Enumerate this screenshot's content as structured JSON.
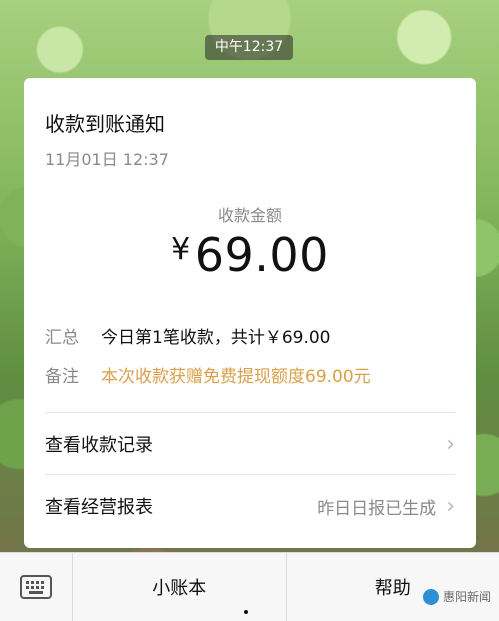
{
  "time_chip": "中午12:37",
  "card": {
    "title": "收款到账通知",
    "datetime": "11月01日 12:37",
    "amount_label": "收款金额",
    "currency": "¥",
    "amount": "69.00",
    "summary_key": "汇总",
    "summary_value": "今日第1笔收款，共计￥69.00",
    "note_key": "备注",
    "note_value": "本次收款获赠免费提现额度69.00元",
    "note_color": "#d9a04a",
    "links": [
      {
        "label": "查看收款记录",
        "right": ""
      },
      {
        "label": "查看经营报表",
        "right": "昨日日报已生成"
      }
    ],
    "chevron": "›"
  },
  "bottom_bar": {
    "keyboard_icon": "keyboard-icon",
    "tabs": [
      "小账本",
      "帮助"
    ]
  },
  "watermark": "惠阳新闻"
}
